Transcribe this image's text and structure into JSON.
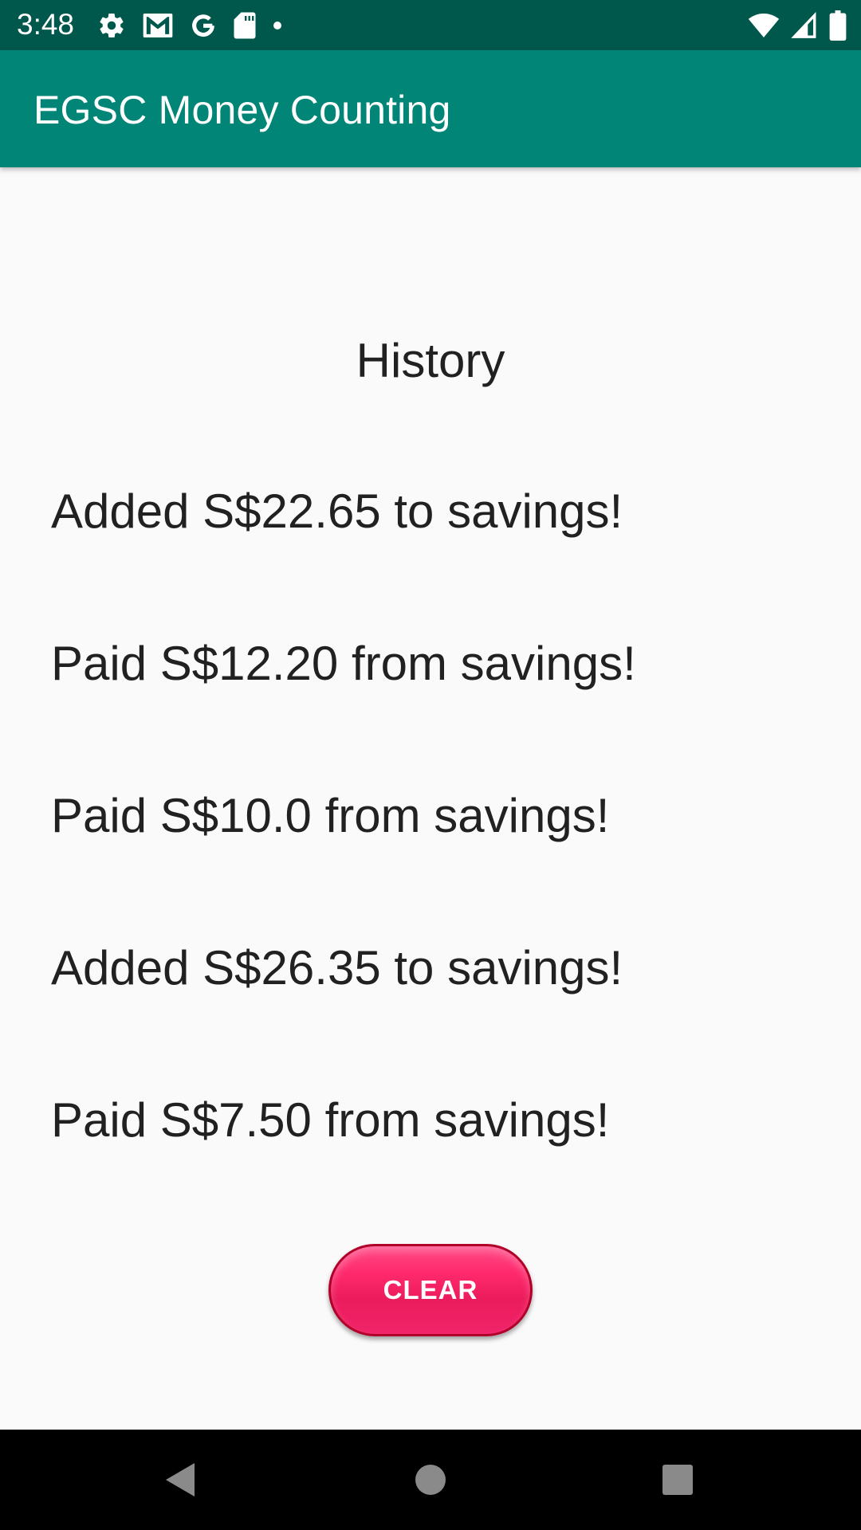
{
  "status_bar": {
    "time": "3:48",
    "left_icons": [
      "settings-icon",
      "gmail-icon",
      "google-icon",
      "sd-card-icon",
      "dot-icon"
    ],
    "right_icons": [
      "wifi-icon",
      "cell-signal-icon",
      "battery-icon"
    ],
    "background": "#00574b"
  },
  "app_bar": {
    "title": "EGSC Money Counting",
    "background": "#008577"
  },
  "main": {
    "heading": "History",
    "history": [
      "Added S$22.65 to savings!",
      "Paid S$12.20 from savings!",
      "Paid S$10.0 from savings!",
      "Added S$26.35 to savings!",
      "Paid S$7.50 from savings!"
    ],
    "clear_label": "CLEAR",
    "clear_color": "#ff2a6d"
  },
  "nav_bar": {
    "icons": [
      "back-icon",
      "home-icon",
      "recents-icon"
    ]
  }
}
